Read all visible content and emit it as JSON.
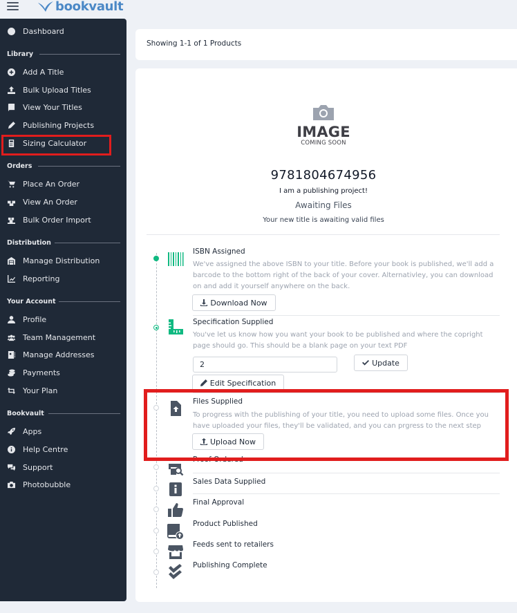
{
  "brand": {
    "name": "bookvault",
    "color": "#4b88c6"
  },
  "colors": {
    "sidebar_bg": "#1f2937",
    "accent_green": "#10b981",
    "highlight_red": "#e11d1d"
  },
  "sidebar": {
    "dashboard": {
      "label": "Dashboard",
      "icon": "dashboard-icon"
    },
    "sections": [
      {
        "label": "Library",
        "items": [
          {
            "label": "Add A Title",
            "icon": "plus-circle-icon"
          },
          {
            "label": "Bulk Upload Titles",
            "icon": "upload-icon"
          },
          {
            "label": "View Your Titles",
            "icon": "book-icon"
          },
          {
            "label": "Publishing Projects",
            "icon": "pen-icon"
          },
          {
            "label": "Sizing Calculator",
            "icon": "calculator-icon"
          }
        ]
      },
      {
        "label": "Orders",
        "items": [
          {
            "label": "Place An Order",
            "icon": "cart-icon"
          },
          {
            "label": "View An Order",
            "icon": "boxes-icon"
          },
          {
            "label": "Bulk Order Import",
            "icon": "pallet-icon"
          }
        ]
      },
      {
        "label": "Distribution",
        "items": [
          {
            "label": "Manage Distribution",
            "icon": "warehouse-icon"
          },
          {
            "label": "Reporting",
            "icon": "line-chart-icon"
          }
        ]
      },
      {
        "label": "Your Account",
        "items": [
          {
            "label": "Profile",
            "icon": "user-icon"
          },
          {
            "label": "Team Management",
            "icon": "users-icon"
          },
          {
            "label": "Manage Addresses",
            "icon": "address-book-icon"
          },
          {
            "label": "Payments",
            "icon": "coins-icon"
          },
          {
            "label": "Your Plan",
            "icon": "retweet-icon"
          }
        ]
      },
      {
        "label": "Bookvault",
        "items": [
          {
            "label": "Apps",
            "icon": "rocket-icon"
          },
          {
            "label": "Help Centre",
            "icon": "info-circle-icon"
          },
          {
            "label": "Support",
            "icon": "chat-icon"
          },
          {
            "label": "Photobubble",
            "icon": "camera-icon"
          }
        ]
      }
    ]
  },
  "results": {
    "showing": "Showing 1-1 of 1 Products"
  },
  "product": {
    "placeholder_big": "IMAGE",
    "placeholder_small": "COMING SOON",
    "isbn": "9781804674956",
    "title": "I am a publishing project!",
    "status": "Awaiting Files",
    "status_detail": "Your new title is awaiting valid files"
  },
  "steps": [
    {
      "title": "ISBN Assigned",
      "state": "done",
      "icon": "barcode-icon",
      "desc": "We've assigned the above ISBN to your title. Before your book is published, we'll add a barcode to the bottom right of the back of your cover. Alternativley, you can download on and add it yourself anywhere on the back.",
      "button": "Download Now"
    },
    {
      "title": "Specification Supplied",
      "state": "current",
      "icon": "ruler-icon",
      "desc": "You've let us know how you want your book to be published and where the copright page should go. This should be a blank page on your text PDF",
      "input_value": "2",
      "update_button": "Update",
      "button": "Edit Specification"
    },
    {
      "title": "Files Supplied",
      "state": "pending",
      "icon": "file-upload-icon",
      "desc": "To progress with the publishing of your title, you need to upload some files. Once you have uploaded your files, they'll be validated, and you can prgress to the next step",
      "button": "Upload Now"
    },
    {
      "title": "Proof Ordered",
      "state": "pending",
      "icon": "print-search-icon"
    },
    {
      "title": "Sales Data Supplied",
      "state": "pending",
      "icon": "info-icon"
    },
    {
      "title": "Final Approval",
      "state": "pending",
      "icon": "thumbs-up-icon"
    },
    {
      "title": "Product Published",
      "state": "pending",
      "icon": "book-upload-icon"
    },
    {
      "title": "Feeds sent to retailers",
      "state": "pending",
      "icon": "store-icon"
    },
    {
      "title": "Publishing Complete",
      "state": "pending",
      "icon": "double-check-icon"
    }
  ]
}
